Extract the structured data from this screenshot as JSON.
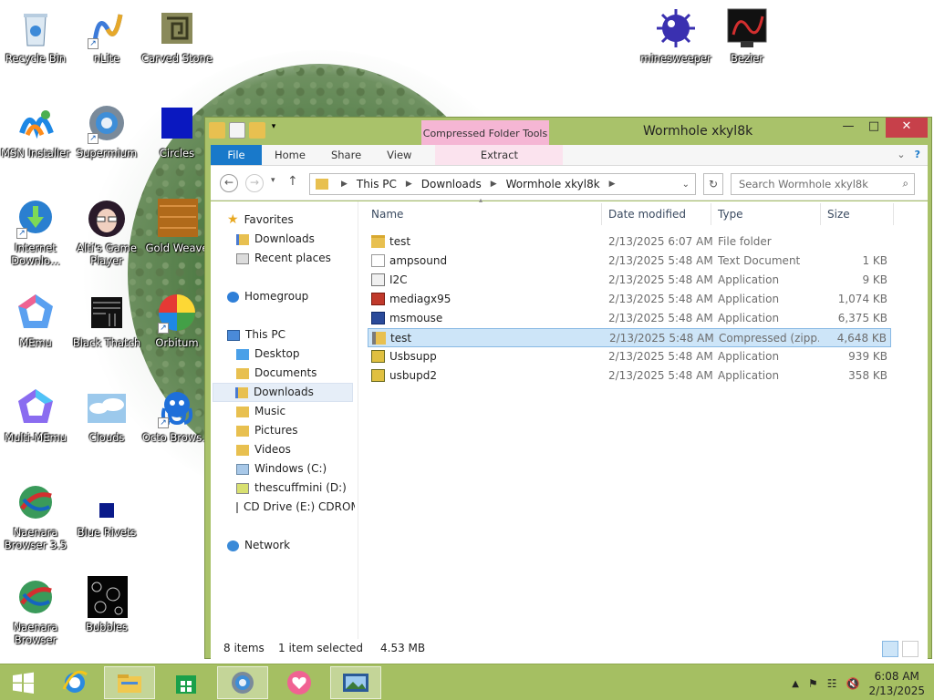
{
  "desktop": {
    "icons": [
      {
        "label": "Recycle Bin",
        "icon": "recycle-bin-icon"
      },
      {
        "label": "nLite",
        "icon": "nlite-icon"
      },
      {
        "label": "Carved Stone",
        "icon": "carved-stone-icon"
      },
      {
        "label": "minesweeper",
        "icon": "minesweeper-icon"
      },
      {
        "label": "Bezier",
        "icon": "bezier-icon"
      },
      {
        "label": "MSN Installer",
        "icon": "msn-icon"
      },
      {
        "label": "Supermium",
        "icon": "supermium-icon"
      },
      {
        "label": "Circles",
        "icon": "circles-icon"
      },
      {
        "label": "Internet Downlo...",
        "icon": "idm-icon"
      },
      {
        "label": "Alti's Game Player",
        "icon": "game-player-icon"
      },
      {
        "label": "Gold Weave",
        "icon": "gold-weave-icon"
      },
      {
        "label": "MEmu",
        "icon": "memu-icon"
      },
      {
        "label": "Black Thatch",
        "icon": "black-thatch-icon"
      },
      {
        "label": "Orbitum",
        "icon": "orbitum-icon"
      },
      {
        "label": "Multi-MEmu",
        "icon": "multi-memu-icon"
      },
      {
        "label": "Clouds",
        "icon": "clouds-icon"
      },
      {
        "label": "Octo Brows...",
        "icon": "octo-browser-icon"
      },
      {
        "label": "Naenara Browser 3.5",
        "icon": "naenara-icon"
      },
      {
        "label": "Blue Rivets",
        "icon": "blue-rivets-icon"
      },
      {
        "label": "Naenara Browser",
        "icon": "naenara-icon"
      },
      {
        "label": "Bubbles",
        "icon": "bubbles-icon"
      }
    ]
  },
  "window": {
    "title": "Wormhole xkyl8k",
    "context_tab": "Compressed Folder Tools",
    "ribbon_tabs": [
      "File",
      "Home",
      "Share",
      "View",
      "Extract"
    ],
    "address": {
      "crumbs": [
        "This PC",
        "Downloads",
        "Wormhole xkyl8k"
      ]
    },
    "search_placeholder": "Search Wormhole xkyl8k",
    "nav": {
      "favorites": "Favorites",
      "downloads_fav": "Downloads",
      "recent": "Recent places",
      "homegroup": "Homegroup",
      "this_pc": "This PC",
      "desktop": "Desktop",
      "documents": "Documents",
      "downloads": "Downloads",
      "music": "Music",
      "pictures": "Pictures",
      "videos": "Videos",
      "windows_c": "Windows (C:)",
      "drive_d": "thescuffmini (D:)",
      "drive_e": "CD Drive (E:) CDROM",
      "network": "Network"
    },
    "columns": {
      "name": "Name",
      "date": "Date modified",
      "type": "Type",
      "size": "Size"
    },
    "files": [
      {
        "name": "test",
        "date": "2/13/2025 6:07 AM",
        "type": "File folder",
        "size": ""
      },
      {
        "name": "ampsound",
        "date": "2/13/2025 5:48 AM",
        "type": "Text Document",
        "size": "1 KB"
      },
      {
        "name": "I2C",
        "date": "2/13/2025 5:48 AM",
        "type": "Application",
        "size": "9 KB"
      },
      {
        "name": "mediagx95",
        "date": "2/13/2025 5:48 AM",
        "type": "Application",
        "size": "1,074 KB"
      },
      {
        "name": "msmouse",
        "date": "2/13/2025 5:48 AM",
        "type": "Application",
        "size": "6,375 KB"
      },
      {
        "name": "test",
        "date": "2/13/2025 5:48 AM",
        "type": "Compressed (zipp...",
        "size": "4,648 KB"
      },
      {
        "name": "Usbsupp",
        "date": "2/13/2025 5:48 AM",
        "type": "Application",
        "size": "939 KB"
      },
      {
        "name": "usbupd2",
        "date": "2/13/2025 5:48 AM",
        "type": "Application",
        "size": "358 KB"
      }
    ],
    "status": {
      "count": "8 items",
      "selected": "1 item selected",
      "size": "4.53 MB"
    }
  },
  "taskbar": {
    "time": "6:08 AM",
    "date": "2/13/2025"
  }
}
